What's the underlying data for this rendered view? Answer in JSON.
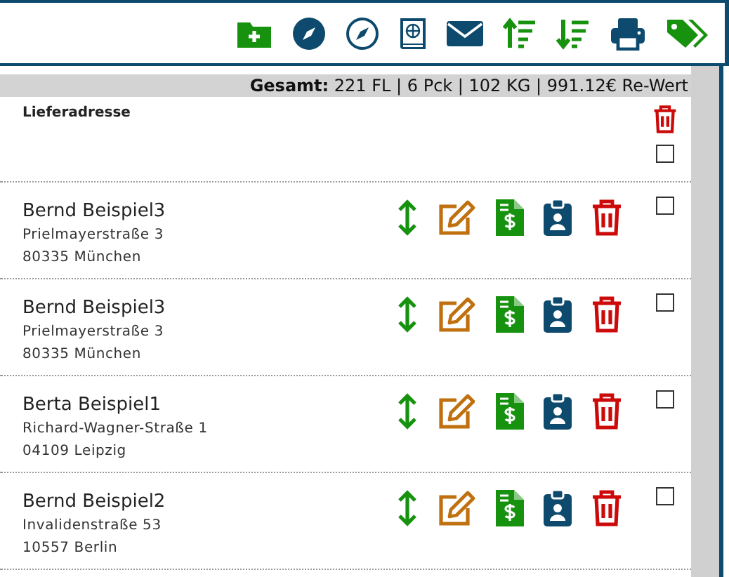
{
  "summary": "**Gesamt:** 221 FL | 6 Pck | 102 KG | 991.12€ Re-Wert",
  "header": {
    "label": "Lieferadresse",
    "checked": false
  },
  "rows": [
    {
      "name": "Bernd Beispiel3",
      "street": "Prielmayerstraße 3",
      "city": "80335 München",
      "checked": false
    },
    {
      "name": "Bernd Beispiel3",
      "street": "Prielmayerstraße 3",
      "city": "80335 München",
      "checked": false
    },
    {
      "name": "Berta Beispiel1",
      "street": "Richard-Wagner-Straße 1",
      "city": "04109 Leipzig",
      "checked": false
    },
    {
      "name": "Bernd Beispiel2",
      "street": "Invalidenstraße 53",
      "city": "10557 Berlin",
      "checked": false
    }
  ]
}
